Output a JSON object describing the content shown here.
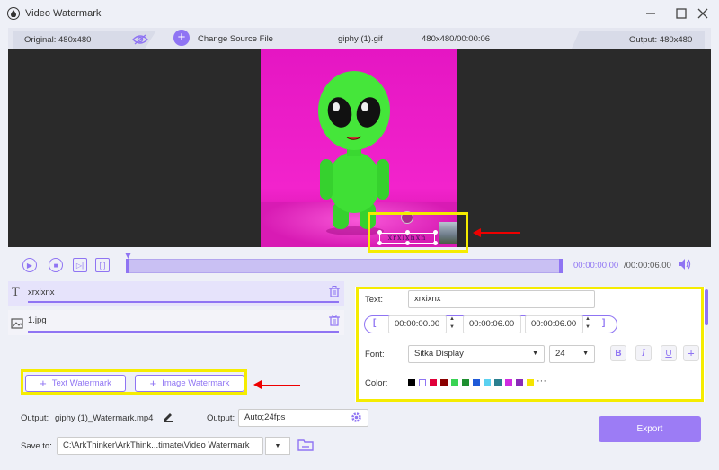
{
  "window": {
    "title": "Video Watermark"
  },
  "info_bar": {
    "original": "Original: 480x480",
    "change_source": "Change Source File",
    "file_name": "giphy (1).gif",
    "file_info": "480x480/00:00:06",
    "output": "Output: 480x480"
  },
  "preview": {
    "watermark_text": "xrxixnxn"
  },
  "timeline": {
    "current": "00:00:00.00",
    "total": "/00:00:06.00"
  },
  "watermarks": [
    {
      "type": "text",
      "label": "xrxixnx"
    },
    {
      "type": "image",
      "label": "1.jpg"
    }
  ],
  "buttons": {
    "text_watermark": "Text Watermark",
    "image_watermark": "Image Watermark",
    "export": "Export"
  },
  "settings": {
    "text_label": "Text:",
    "text_value": "xrxixnx",
    "start_time": "00:00:00.00",
    "end_time": "00:00:06.00",
    "duration": "00:00:06.00",
    "font_label": "Font:",
    "font_value": "Sitka Display",
    "size_value": "24",
    "color_label": "Color:",
    "more": "···"
  },
  "colors": [
    "#000000",
    "#ffffff",
    "#e0003a",
    "#8b0000",
    "#39d353",
    "#1e8f2f",
    "#1f5ad8",
    "#5ad1f0",
    "#2a7f8f",
    "#d02be0",
    "#8a2ab8",
    "#f5e400"
  ],
  "accent": "#8f74f3",
  "bottom": {
    "output_label": "Output:",
    "output_file": "giphy (1)_Watermark.mp4",
    "output_label2": "Output:",
    "output_format": "Auto;24fps",
    "save_label": "Save to:",
    "save_path": "C:\\ArkThinker\\ArkThink...timate\\Video Watermark"
  }
}
